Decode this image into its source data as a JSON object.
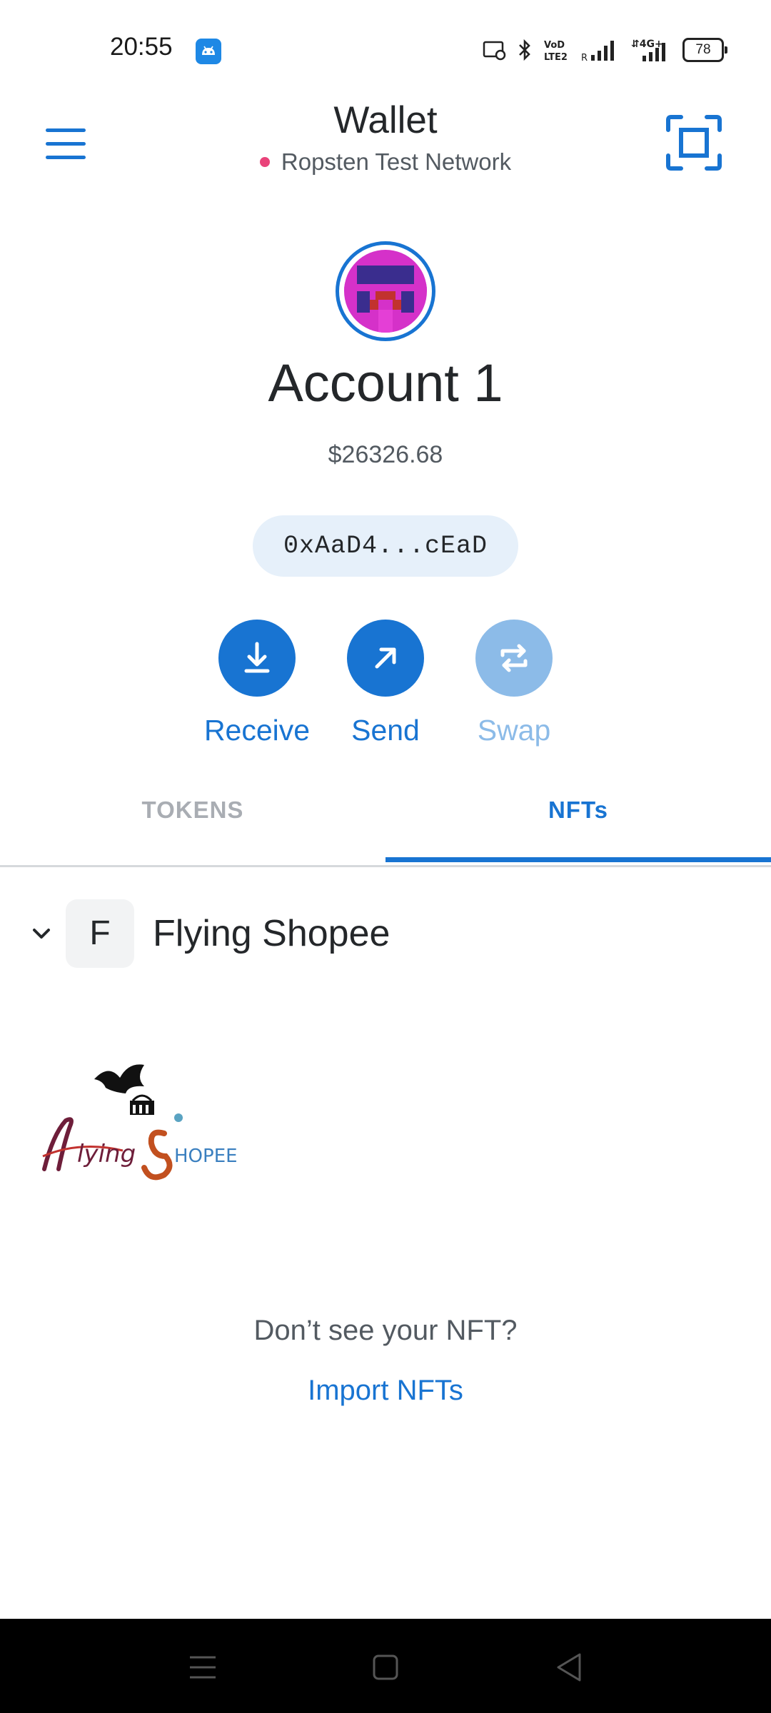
{
  "status_bar": {
    "time": "20:55",
    "battery": "78",
    "network_type": "4G",
    "volte_label": "VoD LTE2",
    "roaming_label": "R"
  },
  "header": {
    "title": "Wallet",
    "network": "Ropsten Test Network",
    "network_dot_color": "#e9437a"
  },
  "account": {
    "name": "Account 1",
    "balance": "$26326.68",
    "address": "0xAaD4...cEaD"
  },
  "actions": {
    "receive_label": "Receive",
    "send_label": "Send",
    "swap_label": "Swap"
  },
  "tabs": {
    "tokens_label": "TOKENS",
    "nfts_label": "NFTs",
    "active": "NFTs"
  },
  "collection": {
    "letter": "F",
    "name": "Flying Shopee",
    "thumbnail_text_a": "lying",
    "thumbnail_text_b": "HOPEE"
  },
  "empty_help": {
    "question": "Don’t see your NFT?",
    "import_label": "Import NFTs"
  },
  "colors": {
    "accent": "#1874d2",
    "disabled": "#8cbbe8",
    "pill_bg": "#e6f0fa"
  },
  "icons": {
    "menu": "hamburger-icon",
    "scan": "scan-qr-icon",
    "receive": "download-icon",
    "send": "arrow-up-right-icon",
    "swap": "swap-arrows-icon",
    "chevron": "chevron-down-icon"
  }
}
